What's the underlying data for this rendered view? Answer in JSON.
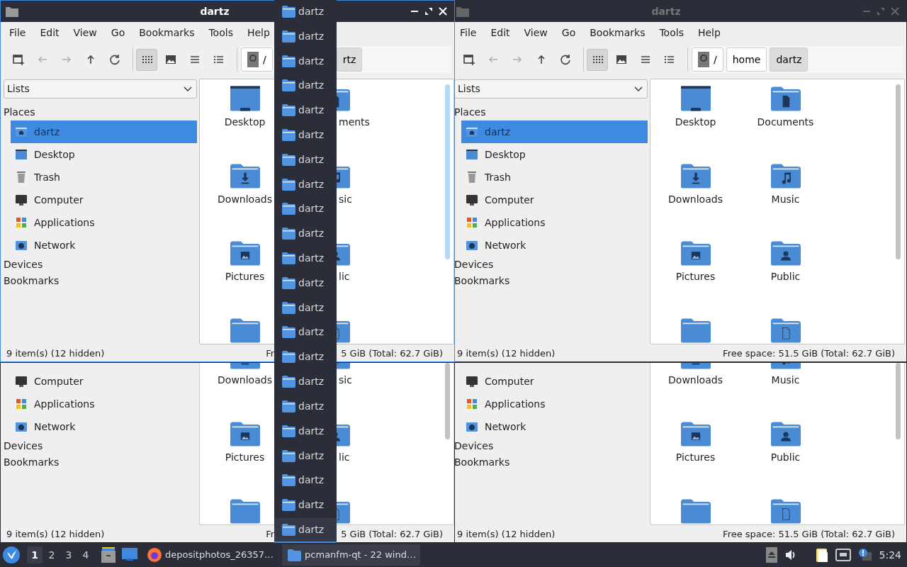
{
  "windows": [
    {
      "active": true,
      "title": "dartz",
      "menu": [
        "File",
        "Edit",
        "View",
        "Go",
        "Bookmarks",
        "Tools",
        "Help"
      ],
      "toolbar": [
        [
          {
            "kind": "new-window",
            "disabled": false
          },
          {
            "kind": "back",
            "disabled": true
          },
          {
            "kind": "forward",
            "disabled": true
          },
          {
            "kind": "up",
            "disabled": false
          },
          {
            "kind": "reload",
            "disabled": false
          }
        ],
        [
          {
            "kind": "icon-view",
            "pressed": true
          },
          {
            "kind": "thumbnail-view",
            "pressed": false
          },
          {
            "kind": "compact-view",
            "pressed": false
          },
          {
            "kind": "detailed-view",
            "pressed": false
          }
        ]
      ],
      "path": [
        {
          "label": "/",
          "kind": "root",
          "pressed": false
        },
        {
          "label": "rtz",
          "kind": "dir",
          "pressed": true
        }
      ],
      "sidebar": {
        "dropdown": "Lists",
        "sections": [
          {
            "heading": "Places",
            "items": [
              {
                "label": "dartz",
                "kind": "home",
                "selected": true
              },
              {
                "label": "Desktop",
                "kind": "desktop",
                "selected": false
              },
              {
                "label": "Trash",
                "kind": "trash",
                "selected": false
              },
              {
                "label": "Computer",
                "kind": "computer",
                "selected": false
              },
              {
                "label": "Applications",
                "kind": "applications",
                "selected": false
              },
              {
                "label": "Network",
                "kind": "network",
                "selected": false
              }
            ]
          },
          {
            "heading": "Devices"
          },
          {
            "heading": "Bookmarks"
          }
        ]
      },
      "files": [
        {
          "label": "Desktop",
          "kind": "desktop"
        },
        {
          "label": "ments",
          "kind": "documents"
        },
        {
          "label": "Downloads",
          "kind": "downloads"
        },
        {
          "label": "sic",
          "kind": "music"
        },
        {
          "label": "Pictures",
          "kind": "pictures"
        },
        {
          "label": "lic",
          "kind": "public"
        },
        {
          "kind": "folder"
        },
        {
          "kind": "templates"
        }
      ],
      "status": {
        "items": "9 item(s) (12 hidden)",
        "free": [
          "Fr",
          "5 GiB (Total: 62.7 GiB)"
        ]
      }
    },
    {
      "active": false,
      "title": "dartz",
      "menu": [
        "File",
        "Edit",
        "View",
        "Go",
        "Bookmarks",
        "Tools",
        "Help"
      ],
      "toolbar": [
        [
          {
            "kind": "new-window",
            "disabled": false
          },
          {
            "kind": "back",
            "disabled": true
          },
          {
            "kind": "forward",
            "disabled": true
          },
          {
            "kind": "up",
            "disabled": false
          },
          {
            "kind": "reload",
            "disabled": false
          }
        ],
        [
          {
            "kind": "icon-view",
            "pressed": true
          },
          {
            "kind": "thumbnail-view",
            "pressed": false
          },
          {
            "kind": "compact-view",
            "pressed": false
          },
          {
            "kind": "detailed-view",
            "pressed": false
          }
        ]
      ],
      "path": [
        {
          "label": "/",
          "kind": "root",
          "pressed": false
        },
        {
          "label": "home",
          "kind": "dir",
          "pressed": false
        },
        {
          "label": "dartz",
          "kind": "dir",
          "pressed": true
        }
      ],
      "sidebar": {
        "dropdown": "Lists",
        "sections": [
          {
            "heading": "Places",
            "items": [
              {
                "label": "dartz",
                "kind": "home",
                "selected": true
              },
              {
                "label": "Desktop",
                "kind": "desktop",
                "selected": false
              },
              {
                "label": "Trash",
                "kind": "trash",
                "selected": false
              },
              {
                "label": "Computer",
                "kind": "computer",
                "selected": false
              },
              {
                "label": "Applications",
                "kind": "applications",
                "selected": false
              },
              {
                "label": "Network",
                "kind": "network",
                "selected": false
              }
            ]
          },
          {
            "heading": "Devices"
          },
          {
            "heading": "Bookmarks"
          }
        ]
      },
      "files": [
        {
          "label": "Desktop",
          "kind": "desktop"
        },
        {
          "label": "Documents",
          "kind": "documents"
        },
        {
          "label": "Downloads",
          "kind": "downloads"
        },
        {
          "label": "Music",
          "kind": "music"
        },
        {
          "label": "Pictures",
          "kind": "pictures"
        },
        {
          "label": "Public",
          "kind": "public"
        },
        {
          "kind": "folder"
        },
        {
          "kind": "templates"
        }
      ],
      "status": {
        "items": "9 item(s) (12 hidden)",
        "free": [
          "Free space: 51.5 GiB (Total: 62.7 GiB)"
        ]
      }
    },
    {
      "active": false,
      "sidebar": {
        "sections": [
          {
            "items": [
              {
                "label": "Computer",
                "kind": "computer",
                "selected": false
              },
              {
                "label": "Applications",
                "kind": "applications",
                "selected": false
              },
              {
                "label": "Network",
                "kind": "network",
                "selected": false
              }
            ]
          },
          {
            "heading": "Devices"
          },
          {
            "heading": "Bookmarks"
          }
        ]
      },
      "files": [
        {
          "label": "Downloads",
          "kind": "downloads"
        },
        {
          "label": "sic",
          "kind": "music"
        },
        {
          "label": "Pictures",
          "kind": "pictures"
        },
        {
          "label": "lic",
          "kind": "public"
        },
        {
          "kind": "folder"
        },
        {
          "kind": "templates"
        }
      ],
      "status": {
        "items": "9 item(s) (12 hidden)",
        "free": [
          "Fr",
          "5 GiB (Total: 62.7 GiB)"
        ]
      }
    },
    {
      "active": false,
      "sidebar": {
        "sections": [
          {
            "items": [
              {
                "label": "Computer",
                "kind": "computer",
                "selected": false
              },
              {
                "label": "Applications",
                "kind": "applications",
                "selected": false
              },
              {
                "label": "Network",
                "kind": "network",
                "selected": false
              }
            ]
          },
          {
            "heading": "Devices"
          },
          {
            "heading": "Bookmarks"
          }
        ]
      },
      "files": [
        {
          "label": "Downloads",
          "kind": "downloads"
        },
        {
          "label": "Music",
          "kind": "music"
        },
        {
          "label": "Pictures",
          "kind": "pictures"
        },
        {
          "label": "Public",
          "kind": "public"
        },
        {
          "kind": "folder"
        },
        {
          "kind": "templates"
        }
      ],
      "status": {
        "items": "9 item(s) (12 hidden)",
        "free": [
          "Free space: 51.5 GiB (Total: 62.7 GiB)"
        ]
      }
    }
  ],
  "window_list": [
    {
      "label": "dartz",
      "selected": false
    },
    {
      "label": "dartz",
      "selected": false
    },
    {
      "label": "dartz",
      "selected": false
    },
    {
      "label": "dartz",
      "selected": false
    },
    {
      "label": "dartz",
      "selected": false
    },
    {
      "label": "dartz",
      "selected": false
    },
    {
      "label": "dartz",
      "selected": false
    },
    {
      "label": "dartz",
      "selected": false
    },
    {
      "label": "dartz",
      "selected": false
    },
    {
      "label": "dartz",
      "selected": false
    },
    {
      "label": "dartz",
      "selected": false
    },
    {
      "label": "dartz",
      "selected": false
    },
    {
      "label": "dartz",
      "selected": false
    },
    {
      "label": "dartz",
      "selected": false
    },
    {
      "label": "dartz",
      "selected": false
    },
    {
      "label": "dartz",
      "selected": false
    },
    {
      "label": "dartz",
      "selected": false
    },
    {
      "label": "dartz",
      "selected": false
    },
    {
      "label": "dartz",
      "selected": false
    },
    {
      "label": "dartz",
      "selected": false
    },
    {
      "label": "dartz",
      "selected": false
    },
    {
      "label": "dartz",
      "selected": true
    }
  ],
  "taskbar": {
    "desktops": [
      {
        "label": "1",
        "selected": true
      },
      {
        "label": "2",
        "selected": false
      },
      {
        "label": "3",
        "selected": false
      },
      {
        "label": "4",
        "selected": false
      }
    ],
    "tasks": [
      {
        "label": "depositphotos_26357…",
        "kind": "browser",
        "selected": false
      },
      {
        "label": "pcmanfm-qt - 22 wind…",
        "kind": "folder",
        "selected": true
      }
    ],
    "clock": "5:24"
  }
}
